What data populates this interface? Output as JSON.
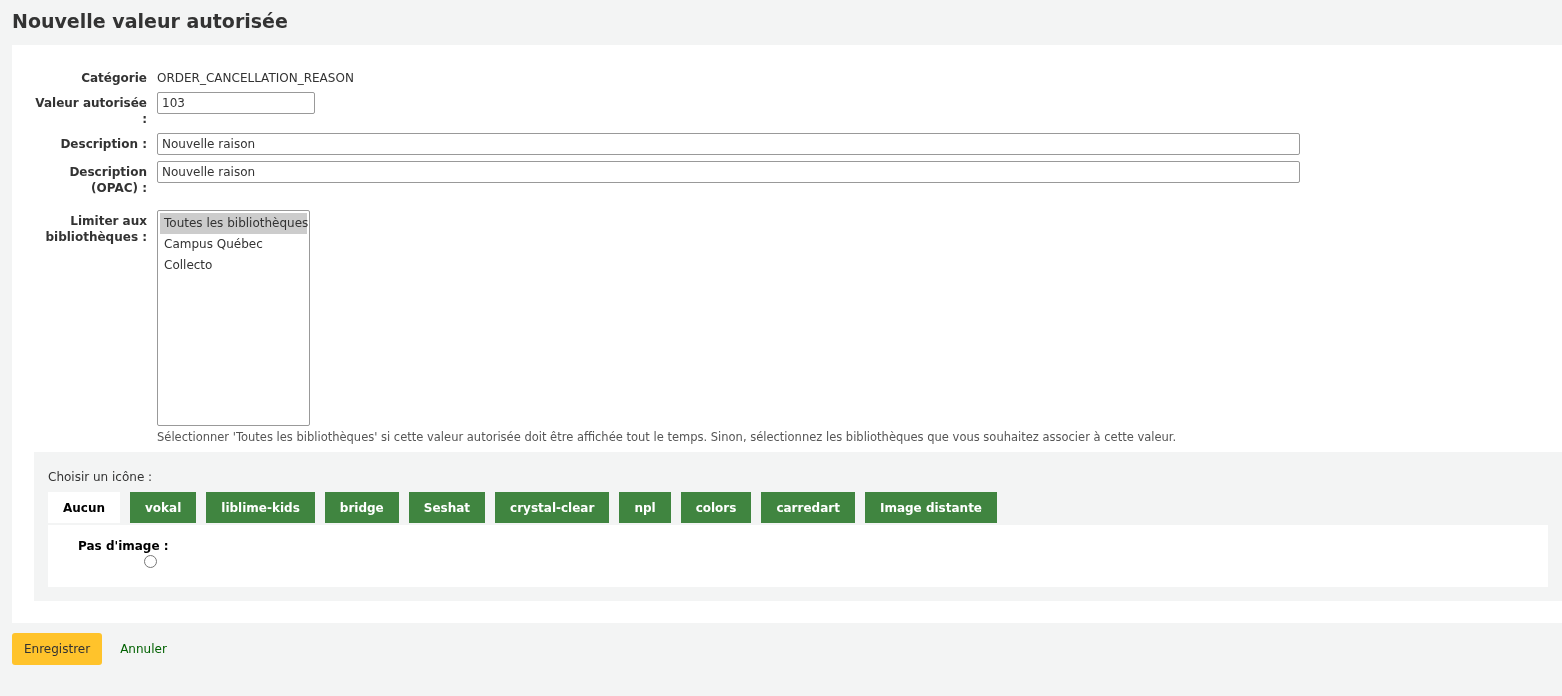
{
  "page_title": "Nouvelle valeur autorisée",
  "category": {
    "label": "Catégorie",
    "value": "ORDER_CANCELLATION_REASON"
  },
  "fields": [
    {
      "label": "Valeur autorisée :",
      "value": "103",
      "kind": "short"
    },
    {
      "label": "Description :",
      "value": "Nouvelle raison",
      "kind": "wide"
    },
    {
      "label": "Description (OPAC) :",
      "value": "Nouvelle raison",
      "kind": "wide"
    }
  ],
  "libraries": {
    "label": "Limiter aux bibliothèques :",
    "items": [
      {
        "label": "Toutes les bibliothèques",
        "selected": true
      },
      {
        "label": "Campus Québec",
        "selected": false
      },
      {
        "label": "Collecto",
        "selected": false
      }
    ],
    "hint": "Sélectionner 'Toutes les bibliothèques' si cette valeur autorisée doit être affichée tout le temps. Sinon, sélectionnez les bibliothèques que vous souhaitez associer à cette valeur."
  },
  "icon_chooser": {
    "label": "Choisir un icône :",
    "tabs": [
      {
        "label": "Aucun",
        "selected": true
      },
      {
        "label": "vokal",
        "selected": false
      },
      {
        "label": "liblime-kids",
        "selected": false
      },
      {
        "label": "bridge",
        "selected": false
      },
      {
        "label": "Seshat",
        "selected": false
      },
      {
        "label": "crystal-clear",
        "selected": false
      },
      {
        "label": "npl",
        "selected": false
      },
      {
        "label": "colors",
        "selected": false
      },
      {
        "label": "carredart",
        "selected": false
      },
      {
        "label": "Image distante",
        "selected": false
      }
    ],
    "option": {
      "label": "Pas d'image :",
      "checked": false
    }
  },
  "buttons": {
    "save": "Enregistrer",
    "cancel": "Annuler"
  }
}
